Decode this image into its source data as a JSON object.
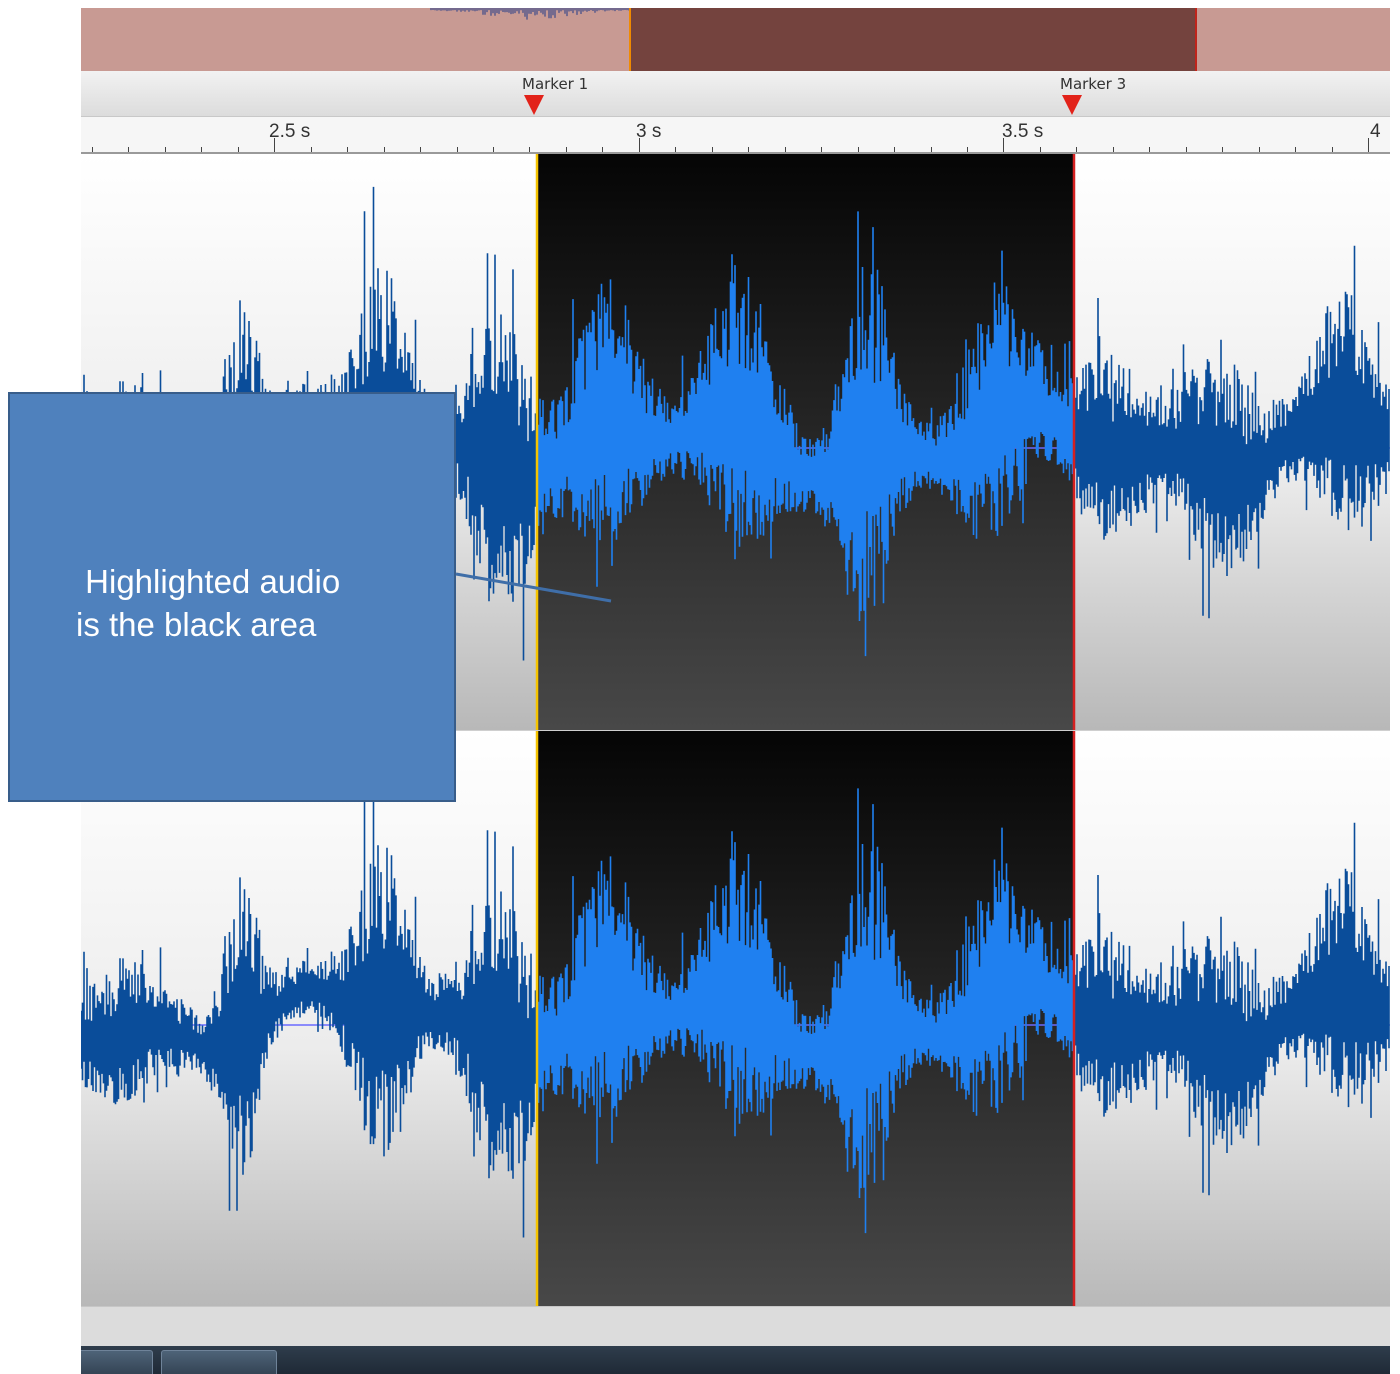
{
  "timeline": {
    "markers": [
      {
        "label": "Marker 1",
        "time": 2.86
      },
      {
        "label": "Marker 3",
        "time": 3.596
      }
    ],
    "ruler_labels": [
      "2.5 s",
      "3 s",
      "3.5 s",
      "4"
    ],
    "ruler_label_times": [
      2.5,
      3.0,
      3.5,
      4.0
    ],
    "visible_range_s": [
      2.235,
      4.03
    ],
    "selection_s": [
      2.86,
      3.596
    ]
  },
  "callout": {
    "text": " Highlighted audio\nis the black area"
  },
  "colors": {
    "waveform": "#0a4d9a",
    "waveform_selected": "#1f80f0",
    "selection_bg_top": "#050505",
    "selection_bg_bottom": "#484848",
    "overview": "#c89a93",
    "overview_selected": "#74433e",
    "marker": "#e2231a",
    "selection_start_line": "#f5c400",
    "selection_end_line": "#d42020",
    "callout_fill": "#4f81bd",
    "center_line": "#6a6aff"
  },
  "icons": [
    "marker-flag-icon",
    "taskbar-app-icon"
  ]
}
